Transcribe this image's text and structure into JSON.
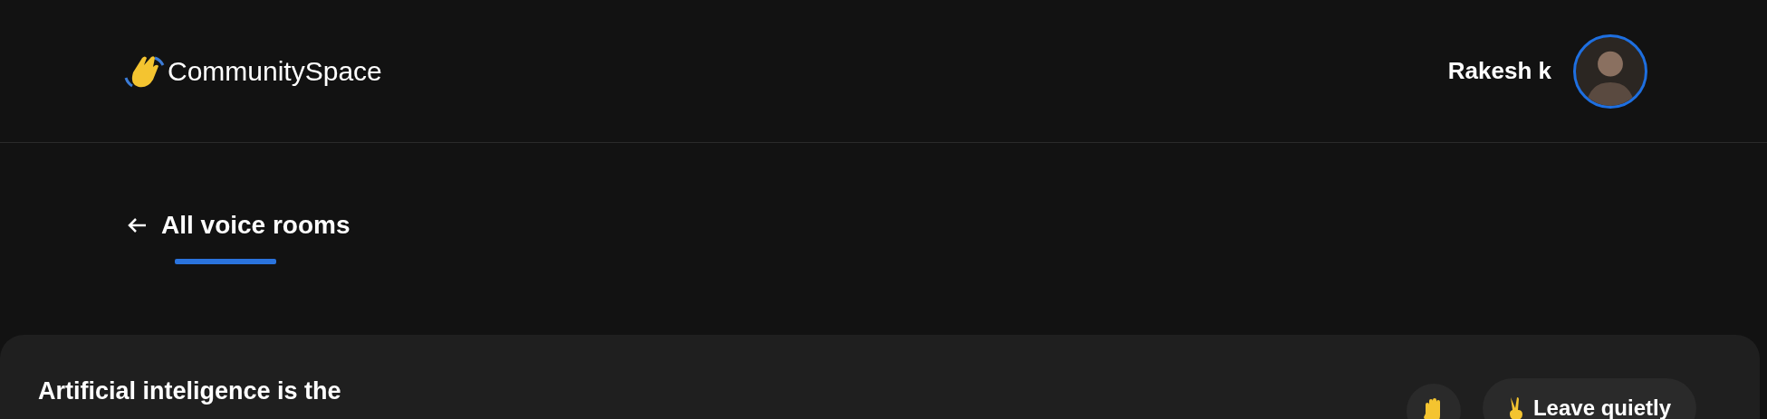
{
  "header": {
    "brand": "CommunitySpace",
    "user": {
      "name": "Rakesh k"
    }
  },
  "back_link": {
    "label": "All voice rooms",
    "selected": true
  },
  "room": {
    "title": "Artificial inteligence is the",
    "actions": [
      {
        "kind": "raise-hand"
      },
      {
        "kind": "leave",
        "label": "Leave quietly"
      }
    ]
  }
}
